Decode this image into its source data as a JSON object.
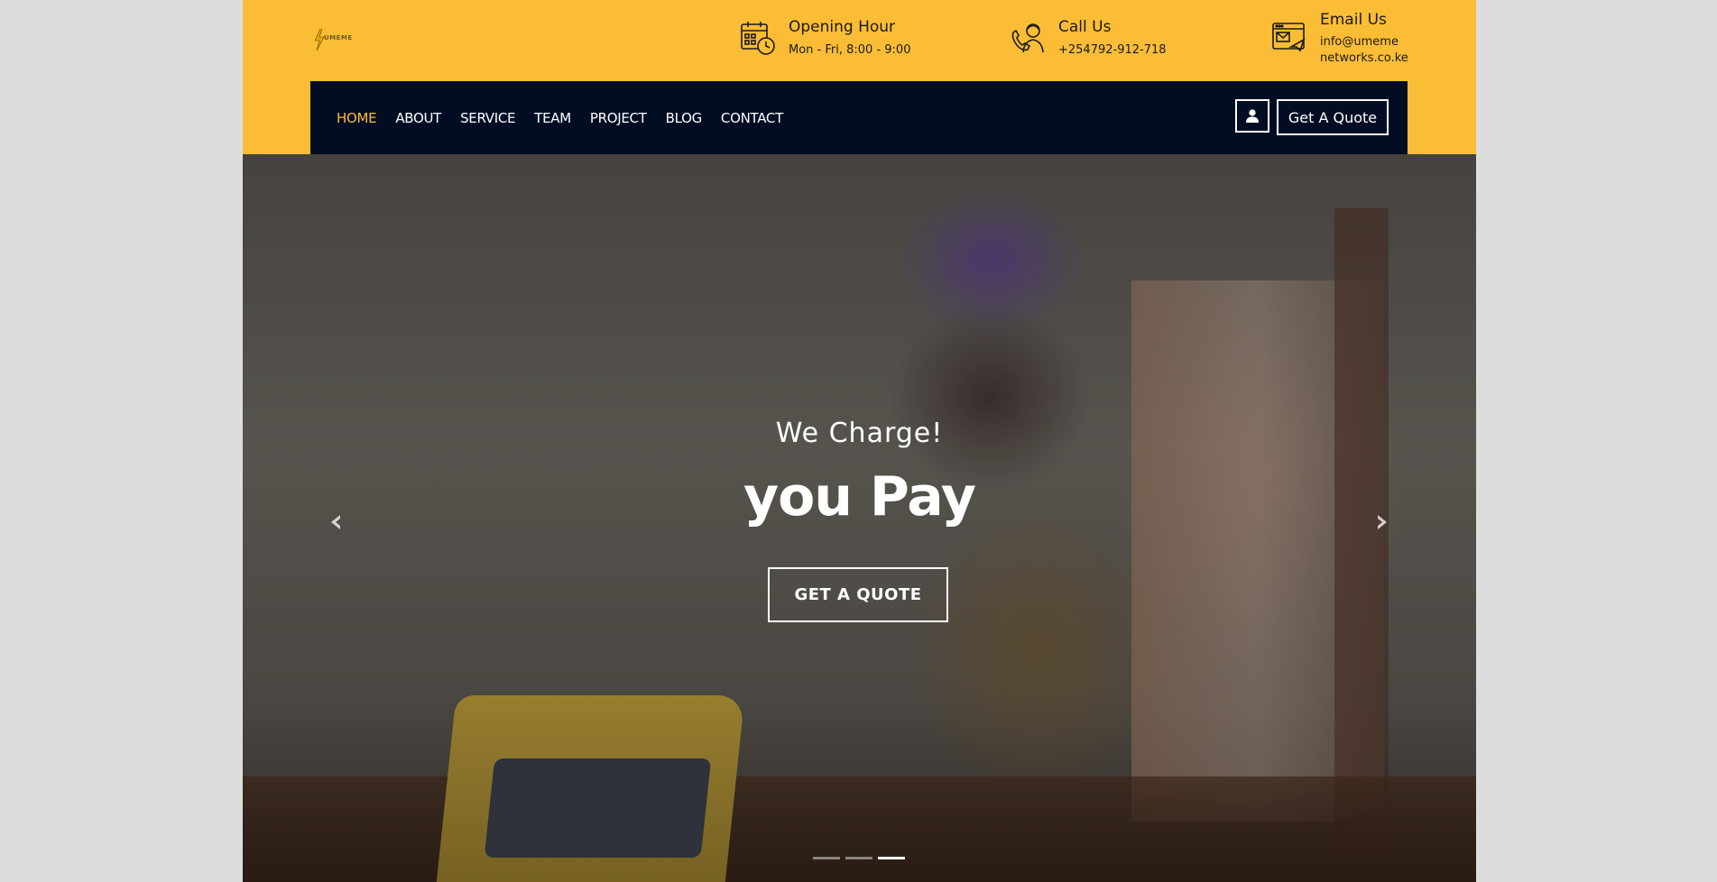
{
  "brand": {
    "wordmark": "UMEME"
  },
  "info": {
    "hours": {
      "title": "Opening Hour",
      "value": "Mon - Fri, 8:00 - 9:00"
    },
    "call": {
      "title": "Call Us",
      "value": "+254792-912-718"
    },
    "email": {
      "title": "Email Us",
      "value_line1": "info@umeme",
      "value_line2": "networks.co.ke"
    }
  },
  "nav": {
    "items": [
      {
        "label": "HOME",
        "active": true
      },
      {
        "label": "ABOUT"
      },
      {
        "label": "SERVICE"
      },
      {
        "label": "TEAM"
      },
      {
        "label": "PROJECT"
      },
      {
        "label": "BLOG"
      },
      {
        "label": "CONTACT"
      }
    ],
    "quote_label": "Get A Quote"
  },
  "hero": {
    "kicker": "We Charge!",
    "headline": "you Pay",
    "button_label": "GET A QUOTE",
    "slides_total": 3,
    "active_slide": 3
  },
  "colors": {
    "brand_yellow": "#fbbd35",
    "nav_dark": "#020d24",
    "page_bg": "#dddddd"
  },
  "icons": [
    "calendar-clock-icon",
    "support-agent-icon",
    "email-icon",
    "user-icon",
    "chevron-left-icon",
    "chevron-right-icon"
  ]
}
